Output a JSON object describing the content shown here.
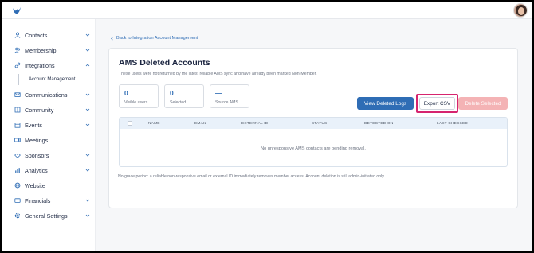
{
  "sidebar": {
    "items": [
      {
        "label": "Contacts",
        "icon": "person-icon",
        "chevron": "down"
      },
      {
        "label": "Membership",
        "icon": "people-icon",
        "chevron": "down"
      },
      {
        "label": "Integrations",
        "icon": "link-icon",
        "chevron": "up"
      },
      {
        "label": "Communications",
        "icon": "mail-icon",
        "chevron": "down"
      },
      {
        "label": "Community",
        "icon": "book-icon",
        "chevron": "down"
      },
      {
        "label": "Events",
        "icon": "calendar-icon",
        "chevron": "down"
      },
      {
        "label": "Meetings",
        "icon": "video-icon",
        "chevron": ""
      },
      {
        "label": "Sponsors",
        "icon": "handshake-icon",
        "chevron": "down"
      },
      {
        "label": "Analytics",
        "icon": "bar-chart-icon",
        "chevron": "down"
      },
      {
        "label": "Website",
        "icon": "globe-icon",
        "chevron": ""
      },
      {
        "label": "Financials",
        "icon": "wallet-icon",
        "chevron": "down"
      },
      {
        "label": "General Settings",
        "icon": "gear-icon",
        "chevron": "down"
      }
    ],
    "sub_item": "Account Management"
  },
  "main": {
    "back_link": "Back to Integration Account Management",
    "title": "AMS Deleted Accounts",
    "subtitle": "These users were not returned by the latest reliable AMS sync and have already been marked Non-Member.",
    "stats": [
      {
        "value": "0",
        "label": "Visible users"
      },
      {
        "value": "0",
        "label": "Selected"
      },
      {
        "value": "—",
        "label": "Source AMS"
      }
    ],
    "buttons": {
      "view_logs": "View Deleted Logs",
      "export_csv": "Export CSV",
      "delete_selected": "Delete Selected"
    },
    "table": {
      "columns": [
        "NAME",
        "EMAIL",
        "EXTERNAL ID",
        "STATUS",
        "DETECTED ON",
        "LAST CHECKED"
      ],
      "empty_message": "No unresponsive AMS contacts are pending removal."
    },
    "footnote": "No grace period: a reliable non-responsive email or external ID immediately removes member access. Account deletion is still admin-initiated only."
  },
  "colors": {
    "accent": "#2f6db5",
    "highlight": "#d6246e",
    "danger_disabled": "#f4b3b5"
  }
}
